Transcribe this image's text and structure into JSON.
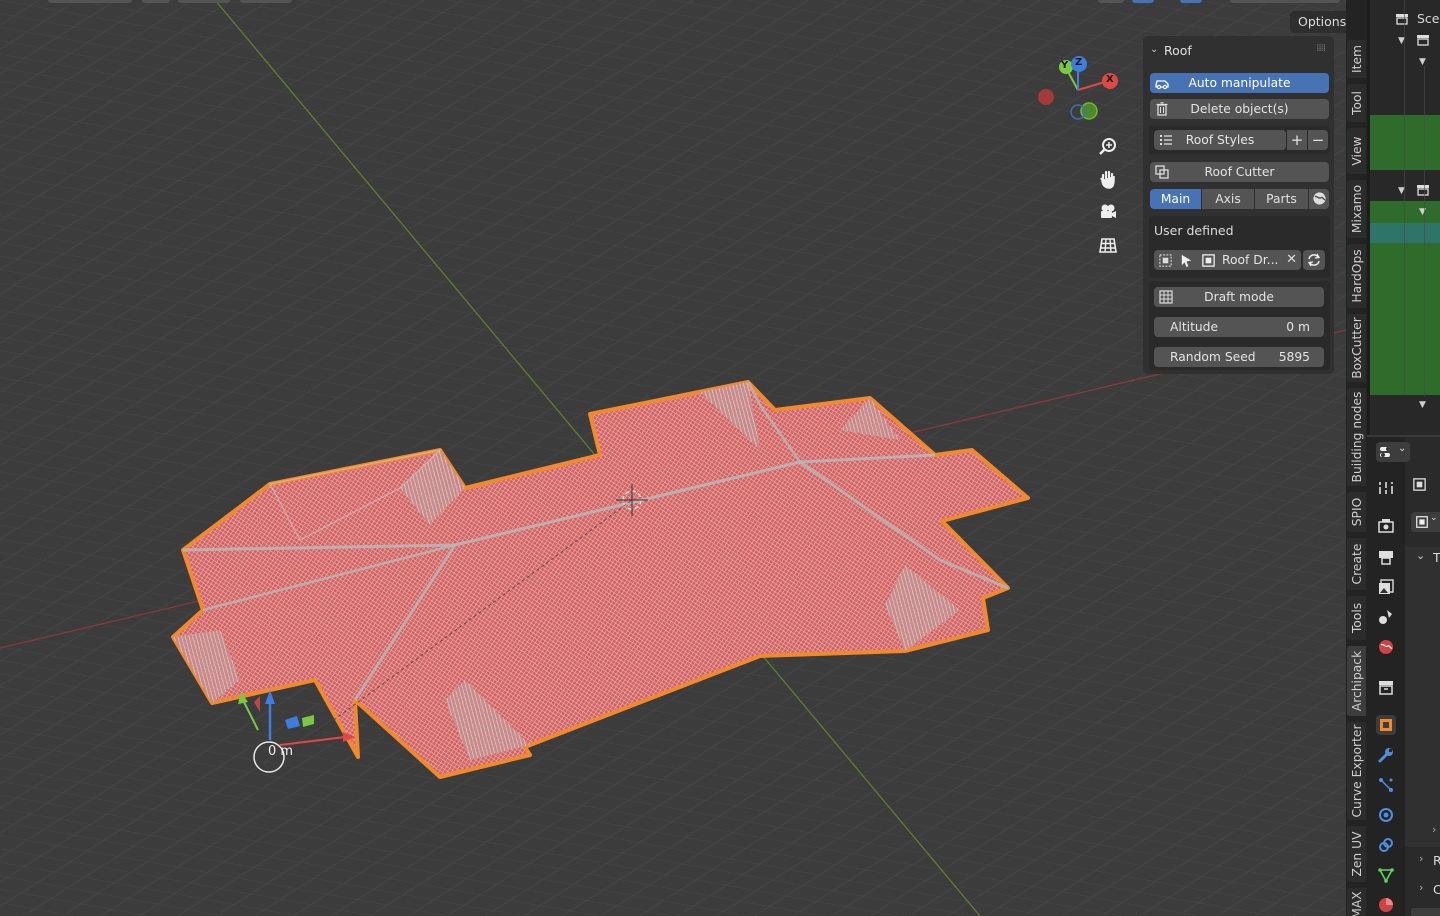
{
  "viewport": {
    "options_label": "Options",
    "measure_text": "0 m",
    "gizmo": {
      "y": "Y",
      "z": "Z",
      "x": "X"
    },
    "nav_tools": [
      "zoom-icon",
      "hand-icon",
      "camera-icon",
      "grid-icon"
    ]
  },
  "panel": {
    "title": "Roof",
    "auto_manipulate": "Auto manipulate",
    "delete_objects": "Delete object(s)",
    "roof_styles": "Roof Styles",
    "add": "+",
    "remove": "−",
    "roof_cutter": "Roof Cutter",
    "tabs": [
      {
        "label": "Main",
        "active": true
      },
      {
        "label": "Axis",
        "active": false
      },
      {
        "label": "Parts",
        "active": false
      }
    ],
    "user_defined": "User defined",
    "roof_draft_name": "Roof Dr...",
    "draft_mode": "Draft mode",
    "altitude": {
      "label": "Altitude",
      "value": "0 m"
    },
    "random_seed": {
      "label": "Random Seed",
      "value": "5895"
    }
  },
  "vertical_tabs": [
    "Item",
    "Tool",
    "View",
    "Mixamo",
    "HardOps",
    "BoxCutter",
    "Building nodes",
    "SPIO",
    "Create",
    "Tools",
    "Archipack",
    "Curve Exporter",
    "Zen UV",
    "MAX"
  ],
  "outliner": {
    "scene_label": "Sce"
  },
  "properties": {
    "section_letters": [
      "T",
      "R",
      "C"
    ]
  },
  "colors": {
    "accent_blue": "#4772b3",
    "roof_red": "#e04b4b",
    "selection_orange": "#f08a2c",
    "outliner_green": "#2f6b2a"
  }
}
